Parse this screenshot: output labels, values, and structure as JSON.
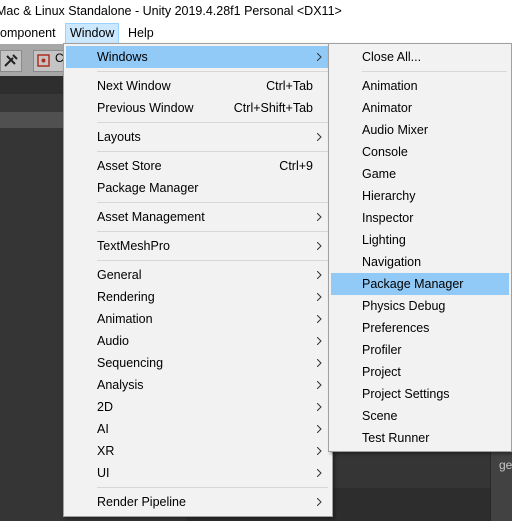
{
  "title": "Mac & Linux Standalone - Unity 2019.4.28f1 Personal <DX11>",
  "menubar": {
    "items": [
      {
        "label": "omponent"
      },
      {
        "label": "Window"
      },
      {
        "label": "Help"
      }
    ]
  },
  "toolbar": {
    "label": "C"
  },
  "side_text": "ge",
  "window_menu": {
    "items": [
      {
        "label": "Windows",
        "submenu": true
      },
      {
        "label": "Next Window",
        "shortcut": "Ctrl+Tab"
      },
      {
        "label": "Previous Window",
        "shortcut": "Ctrl+Shift+Tab"
      },
      {
        "label": "Layouts",
        "submenu": true
      },
      {
        "label": "Asset Store",
        "shortcut": "Ctrl+9"
      },
      {
        "label": "Package Manager"
      },
      {
        "label": "Asset Management",
        "submenu": true
      },
      {
        "label": "TextMeshPro",
        "submenu": true
      },
      {
        "label": "General",
        "submenu": true
      },
      {
        "label": "Rendering",
        "submenu": true
      },
      {
        "label": "Animation",
        "submenu": true
      },
      {
        "label": "Audio",
        "submenu": true
      },
      {
        "label": "Sequencing",
        "submenu": true
      },
      {
        "label": "Analysis",
        "submenu": true
      },
      {
        "label": "2D",
        "submenu": true
      },
      {
        "label": "AI",
        "submenu": true
      },
      {
        "label": "XR",
        "submenu": true
      },
      {
        "label": "UI",
        "submenu": true
      },
      {
        "label": "Render Pipeline",
        "submenu": true
      }
    ]
  },
  "windows_submenu": {
    "items": [
      {
        "label": "Close All..."
      },
      {
        "label": "Animation"
      },
      {
        "label": "Animator"
      },
      {
        "label": "Audio Mixer"
      },
      {
        "label": "Console"
      },
      {
        "label": "Game"
      },
      {
        "label": "Hierarchy"
      },
      {
        "label": "Inspector"
      },
      {
        "label": "Lighting"
      },
      {
        "label": "Navigation"
      },
      {
        "label": "Package Manager"
      },
      {
        "label": "Physics Debug"
      },
      {
        "label": "Preferences"
      },
      {
        "label": "Profiler"
      },
      {
        "label": "Project"
      },
      {
        "label": "Project Settings"
      },
      {
        "label": "Scene"
      },
      {
        "label": "Test Runner"
      }
    ]
  },
  "colors": {
    "menu_highlight": "#91c9f7",
    "menubar_active": "#cce8ff"
  }
}
